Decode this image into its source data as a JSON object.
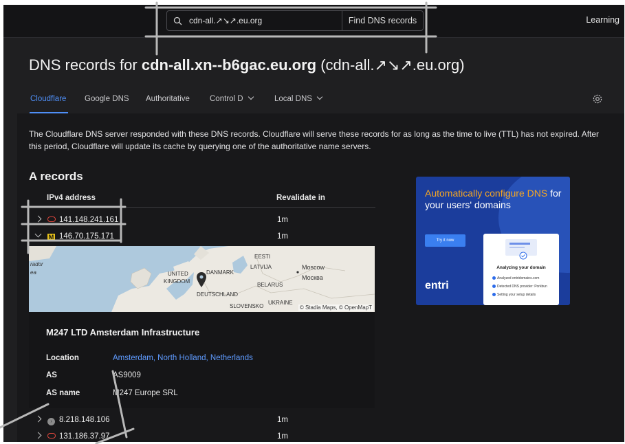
{
  "header": {
    "search_value": "cdn-all.↗\u0000↘↗.eu.org",
    "search_button": "Find DNS records",
    "learning_link": "Learning"
  },
  "title": {
    "prefix": "DNS records for ",
    "domain": "cdn-all.xn--b6gac.eu.org",
    "unicode": " (cdn-all.↗↘↗.eu.org)"
  },
  "tabs": [
    {
      "label": "Cloudflare",
      "active": true
    },
    {
      "label": "Google DNS"
    },
    {
      "label": "Authoritative"
    },
    {
      "label": "Control D"
    },
    {
      "label": "Local DNS"
    }
  ],
  "description": "The Cloudflare DNS server responded with these DNS records. Cloudflare will serve these records for as long as the time to live (TTL) has not expired. After this period, Cloudflare will update its cache by querying one of the authoritative name servers.",
  "a_records": {
    "heading": "A records",
    "col_ip": "IPv4 address",
    "col_revalidate": "Revalidate in",
    "rows": [
      {
        "ip": "141.148.241.161",
        "revalidate": "1m",
        "icon": "oracle-icon",
        "expanded": false
      },
      {
        "ip": "146.70.175.171",
        "revalidate": "1m",
        "icon": "m247-icon",
        "expanded": true
      },
      {
        "ip": "8.218.148.106",
        "revalidate": "1m",
        "icon": "alibaba-icon",
        "expanded": false
      },
      {
        "ip": "131.186.37.97",
        "revalidate": "1m",
        "icon": "oracle-icon",
        "expanded": false
      }
    ],
    "icon_glyphs": {
      "m247": "M",
      "alibaba": "›"
    }
  },
  "map": {
    "labels": [
      "rador",
      "ea",
      "EESTI",
      "LATVIJA",
      "Moscow",
      "Москва",
      "UNITED",
      "KINGDOM",
      "DANMARK",
      "DEUTSCHLAND",
      "BELARUS",
      "UKRAINE",
      "SLOVENSKO"
    ],
    "attribution": "© Stadia Maps, © OpenMapT"
  },
  "detail": {
    "title": "M247 LTD Amsterdam Infrastructure",
    "location_label": "Location",
    "location_value": "Amsterdam, North Holland, Netherlands",
    "as_label": "AS",
    "as_value": "AS9009",
    "as_name_label": "AS name",
    "as_name_value": "M247 Europe SRL"
  },
  "ad": {
    "headline_orange": "Automatically configure DNS",
    "headline_white": " for your users' domains",
    "button": "Try it now",
    "card_title": "Analyzing your domain",
    "card_items": [
      "Analyzed entridomains.com",
      "Detected DNS provider: Porkbun",
      "Setting your setup details"
    ],
    "logo": "entri"
  },
  "colors": {
    "accent": "#4f8ff7",
    "background": "#1f1f21",
    "panel": "#18181a",
    "ad_blue": "#1b3d9c"
  }
}
